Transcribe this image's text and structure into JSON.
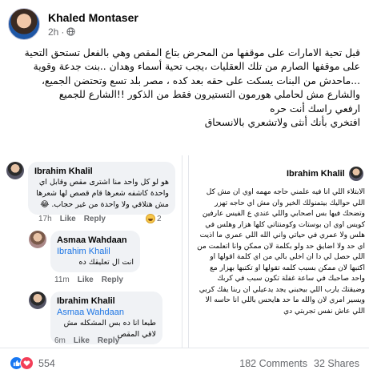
{
  "post": {
    "author": "Khaled Montaser",
    "time": "2h",
    "dot": "·",
    "paragraphs": [
      "قبل تحية الامارات على موقفها من المحرض بتاع المقص وهي بالفعل تستحق التحية على موقفها الصارم من تلك العقليات ،يجب تحية أسماء وهدان ..بنت جدعة وقوية ...ماحدش من البنات يسكت على حقه بعد كده ، مصر بلد تسع وتحتضن الجميع، والشارع مش لحاملي هورمون التستيرون فقط من الذكور !!الشارع للجميع",
      "ارفعي راسك أنت حره",
      "افتخري بأنك أنثى ولاتشعري بالانسحاق"
    ]
  },
  "comments_screenshot": {
    "c1": {
      "name": "Ibrahim Khalil",
      "text": "هو لو كل واحد منا اشترى مقص وقابل اي واحدة كاشفه شعرها قام قصص لها شعرها مش هتلاقي ولا واحدة من غير حجاب. 😂",
      "time": "17h",
      "like": "Like",
      "reply": "Reply",
      "reacts": "2"
    },
    "c2": {
      "name": "Asmaa Wahdaan",
      "mention": "Ibrahim Khalil",
      "text": "انت ال تعليقك ده",
      "time": "11m",
      "like": "Like",
      "reply": "Reply"
    },
    "c3": {
      "name": "Ibrahim Khalil",
      "mention": "Asmaa Wahdaan",
      "text": "طبعا انا ده بس المشكله مش لاقي المقص",
      "time": "6m",
      "like": "Like",
      "reply": "Reply"
    }
  },
  "post_screenshot": {
    "name": "Ibrahim Khalil",
    "text": "الابتلاء اللي انا فيه علمني حاجه مهمه اوي ان مش كل اللي حواليك بيتمنولك الخير وان مش اي حاجه تهزر وتضحك فيها بس اصحابي واللي عندي ع الفيس عارفين كويس اوي ان بوستات وكومنتاتي كلها هزار وهلس في هلس ولا عمري في حياتي واني الله اللي عمري ما اذيت اي حد ولا اضايق حد ولو بكلمة لان ممكن وانا اتعلمت من اللي حصل لي دا ان اخلي بالي من اي كلمة اقولها او اكتبها لان ممكن بسبب كلمه تقولها او تكتبها بهزار مع واحد صاحبك في ساعة غفلة تكون سبب في كربك وضيقتك يارب اللي بيحبني يجد يدعيلي ان ربنا يفك كربي ويسير امري لان والله ما حد هايحس باللي انا حاسه الا اللي عاش نفس تجربتي دي"
  },
  "footer": {
    "reactions_count": "554",
    "comments": "182 Comments",
    "shares": "32 Shares"
  },
  "colors": {
    "like": "#1877f2",
    "love": "#f33e58",
    "mention": "#1b74e4"
  }
}
